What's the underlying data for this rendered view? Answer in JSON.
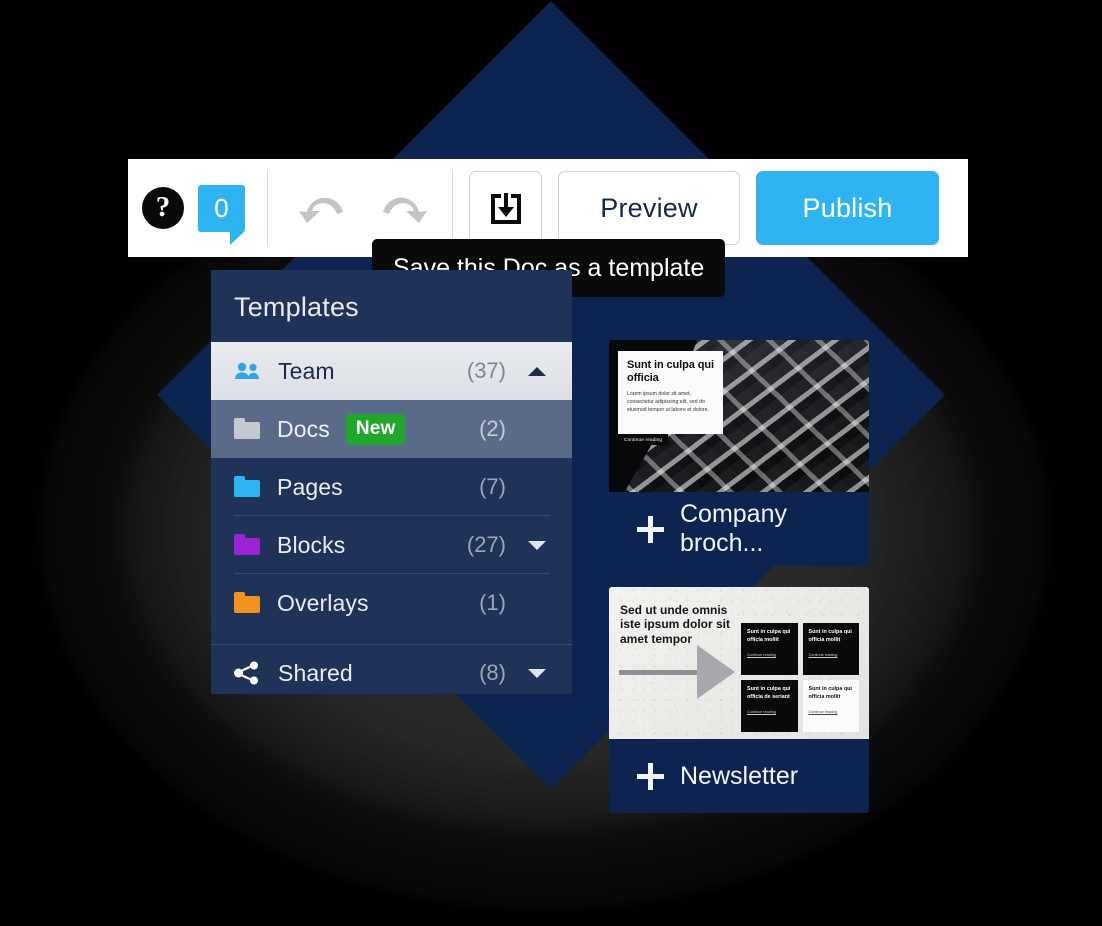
{
  "toolbar": {
    "help_icon": "question-mark-circle-icon",
    "comment_count": "0",
    "undo_icon": "undo-arrow-icon",
    "redo_icon": "redo-arrow-icon",
    "save_template_icon": "save-download-icon",
    "preview_label": "Preview",
    "publish_label": "Publish",
    "publish_color": "#2fb4f3",
    "comment_badge_color": "#2fb4f3"
  },
  "tooltip": {
    "text": "Save this Doc as a template"
  },
  "panel": {
    "title": "Templates",
    "items": [
      {
        "label": "Team",
        "count": "(37)",
        "icon": "people-icon",
        "icon_color": "#2fa6e8",
        "badge": "",
        "chevron": "up",
        "state": "selected"
      },
      {
        "label": "Docs",
        "count": "(2)",
        "icon": "folder-icon",
        "icon_color": "#c4c9d1",
        "badge": "New",
        "chevron": "",
        "state": "sub"
      },
      {
        "label": "Pages",
        "count": "(7)",
        "icon": "folder-icon",
        "icon_color": "#2fb4f3",
        "badge": "",
        "chevron": "",
        "state": "normal"
      },
      {
        "label": "Blocks",
        "count": "(27)",
        "icon": "folder-icon",
        "icon_color": "#9b22d6",
        "badge": "",
        "chevron": "down",
        "state": "normal"
      },
      {
        "label": "Overlays",
        "count": "(1)",
        "icon": "folder-icon",
        "icon_color": "#f0941f",
        "badge": "",
        "chevron": "",
        "state": "normal"
      },
      {
        "label": "Shared",
        "count": "(8)",
        "icon": "share-icon",
        "icon_color": "#ffffff",
        "badge": "",
        "chevron": "down",
        "state": "normal"
      }
    ],
    "badge_color": "#1fa82a"
  },
  "cards": [
    {
      "name": "Company broch...",
      "add_icon": "plus-icon",
      "thumb": {
        "heading": "Sunt in culpa qui officia",
        "body": "Lorem ipsum dolor sit amet, consectetur adipiscing elit, sed do eiusmod tempor ut labore et dolore.",
        "cta": "Continue reading"
      }
    },
    {
      "name": "Newsletter",
      "add_icon": "plus-icon",
      "thumb": {
        "heading": "Sed ut unde omnis iste ipsum dolor sit amet tempor",
        "minis": [
          {
            "heading": "Sunt in culpa qui officia mollit",
            "cta": "Continue reading",
            "theme": "dark"
          },
          {
            "heading": "Sunt in culpa qui officia mollit",
            "cta": "Continue reading",
            "theme": "dark"
          },
          {
            "heading": "Sunt in culpa qui officia de seriant",
            "cta": "Continue reading",
            "theme": "dark"
          },
          {
            "heading": "Sunt in culpa qui officia mollit",
            "cta": "Continue reading",
            "theme": "light"
          }
        ]
      }
    }
  ]
}
